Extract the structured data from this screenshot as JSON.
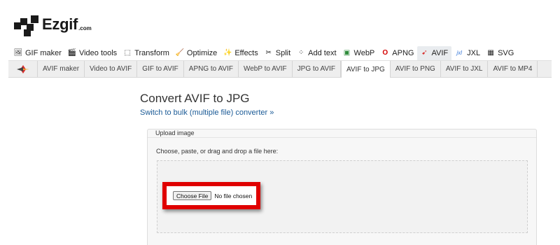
{
  "brand": {
    "name": "Ezgif",
    "suffix": ".com"
  },
  "main_nav": [
    {
      "name": "nav-gif-maker",
      "label": "GIF maker",
      "icon": "film-image-icon",
      "glyph": "🖼"
    },
    {
      "name": "nav-video-tools",
      "label": "Video tools",
      "icon": "clapperboard-icon",
      "glyph": "🎬"
    },
    {
      "name": "nav-transform",
      "label": "Transform",
      "icon": "transform-icon",
      "glyph": "⬚"
    },
    {
      "name": "nav-optimize",
      "label": "Optimize",
      "icon": "broom-icon",
      "glyph": "🧹"
    },
    {
      "name": "nav-effects",
      "label": "Effects",
      "icon": "magic-wand-icon",
      "glyph": "✨"
    },
    {
      "name": "nav-split",
      "label": "Split",
      "icon": "scissors-icon",
      "glyph": "✂"
    },
    {
      "name": "nav-add-text",
      "label": "Add text",
      "icon": "text-icon",
      "glyph": "⁘"
    },
    {
      "name": "nav-webp",
      "label": "WebP",
      "icon": "webp-icon",
      "glyph": "▣"
    },
    {
      "name": "nav-apng",
      "label": "APNG",
      "icon": "apng-icon",
      "glyph": "O"
    },
    {
      "name": "nav-avif",
      "label": "AVIF",
      "icon": "avif-icon",
      "glyph": "➹",
      "active": true
    },
    {
      "name": "nav-jxl",
      "label": "JXL",
      "icon": "jxl-icon",
      "glyph": "jxl"
    },
    {
      "name": "nav-svg",
      "label": "SVG",
      "icon": "svg-icon",
      "glyph": "▦"
    }
  ],
  "sub_nav": [
    {
      "label": "AVIF maker"
    },
    {
      "label": "Video to AVIF"
    },
    {
      "label": "GIF to AVIF"
    },
    {
      "label": "APNG to AVIF"
    },
    {
      "label": "WebP to AVIF"
    },
    {
      "label": "JPG to AVIF"
    },
    {
      "label": "AVIF to JPG",
      "active": true
    },
    {
      "label": "AVIF to PNG"
    },
    {
      "label": "AVIF to JXL"
    },
    {
      "label": "AVIF to MP4"
    }
  ],
  "page": {
    "title": "Convert AVIF to JPG",
    "bulk_link": "Switch to bulk (multiple file) converter »"
  },
  "upload": {
    "legend": "Upload image",
    "instructions": "Choose, paste, or drag and drop a file here:",
    "choose_button": "Choose File",
    "file_status": "No file chosen"
  },
  "colors": {
    "accent_link": "#1a5a96",
    "highlight_border": "#e00000",
    "subnav_bg": "#eeeeee"
  }
}
